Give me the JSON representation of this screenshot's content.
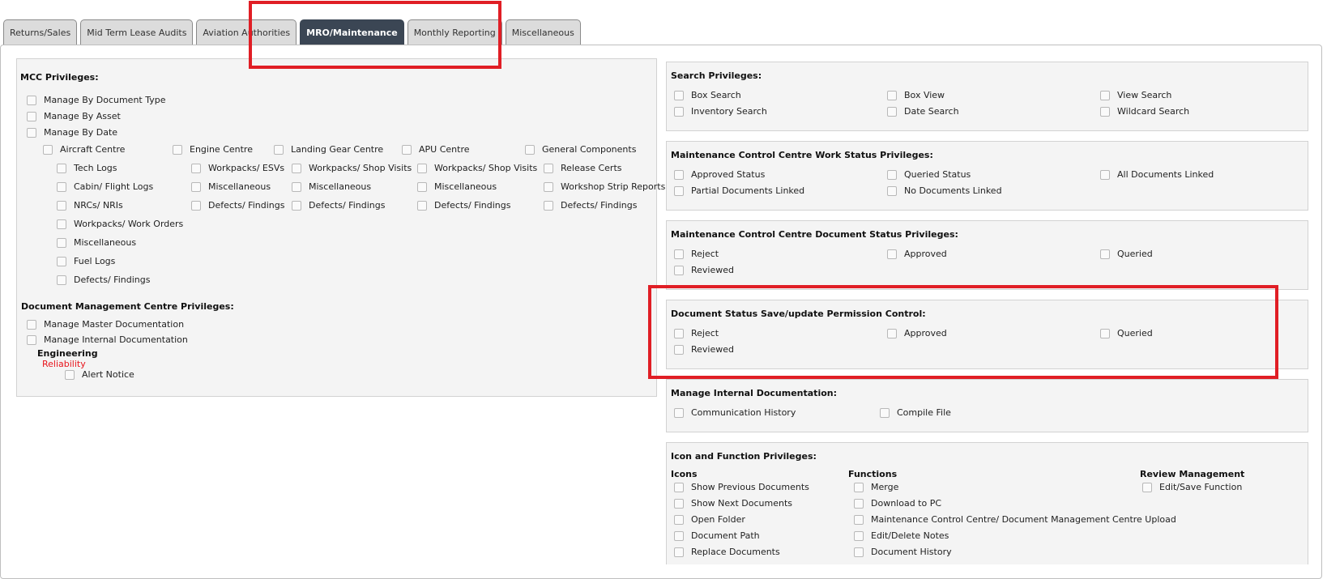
{
  "tabs": [
    {
      "label": "Returns/Sales",
      "active": false
    },
    {
      "label": "Mid Term Lease Audits",
      "active": false
    },
    {
      "label": "Aviation Authorities",
      "active": false
    },
    {
      "label": "MRO/Maintenance",
      "active": true
    },
    {
      "label": "Monthly Reporting",
      "active": false
    },
    {
      "label": "Miscellaneous",
      "active": false
    }
  ],
  "mcc": {
    "title": "MCC Privileges:",
    "manage": [
      "Manage By Document Type",
      "Manage By Asset",
      "Manage By Date"
    ],
    "centres": [
      "Aircraft Centre",
      "Engine Centre",
      "Landing Gear Centre",
      "APU Centre",
      "General Components"
    ],
    "aircraft_items": [
      "Tech Logs",
      "Cabin/ Flight Logs",
      "NRCs/ NRIs",
      "Workpacks/ Work Orders",
      "Miscellaneous",
      "Fuel Logs",
      "Defects/ Findings"
    ],
    "engine_items": [
      "Workpacks/ ESVs",
      "Miscellaneous",
      "Defects/ Findings"
    ],
    "landing_items": [
      "Workpacks/ Shop Visits",
      "Miscellaneous",
      "Defects/ Findings"
    ],
    "apu_items": [
      "Workpacks/ Shop Visits",
      "Miscellaneous",
      "Defects/ Findings"
    ],
    "general_items": [
      "Release Certs",
      "Workshop Strip Reports",
      "Defects/ Findings"
    ]
  },
  "dmc": {
    "title": "Document Management Centre Privileges:",
    "items": [
      "Manage Master Documentation",
      "Manage Internal Documentation"
    ],
    "engineering": "Engineering",
    "reliability": "Reliability",
    "alert": "Alert Notice"
  },
  "search": {
    "title": "Search Privileges:",
    "items": [
      "Box Search",
      "Box View",
      "View Search",
      "Inventory Search",
      "Date Search",
      "Wildcard Search"
    ]
  },
  "work_status": {
    "title": "Maintenance Control Centre Work Status Privileges:",
    "items": [
      "Approved Status",
      "Queried Status",
      "All Documents Linked",
      "Partial Documents Linked",
      "No Documents Linked"
    ]
  },
  "doc_status": {
    "title": "Maintenance Control Centre Document Status Privileges:",
    "items": [
      "Reject",
      "Approved",
      "Queried",
      "Reviewed"
    ]
  },
  "save_update": {
    "title": "Document Status Save/update Permission Control:",
    "items": [
      "Reject",
      "Approved",
      "Queried",
      "Reviewed"
    ]
  },
  "internal_doc": {
    "title": "Manage Internal Documentation:",
    "items": [
      "Communication History",
      "Compile File"
    ]
  },
  "icon_func": {
    "title": "Icon and Function Privileges:",
    "icons_head": "Icons",
    "functions_head": "Functions",
    "review_head": "Review Management",
    "icons": [
      "Show Previous Documents",
      "Show Next Documents",
      "Open Folder",
      "Document Path",
      "Replace Documents"
    ],
    "functions": [
      "Merge",
      "Download to PC",
      "Maintenance Control Centre/ Document Management Centre Upload",
      "Edit/Delete Notes",
      "Document History"
    ],
    "review": [
      "Edit/Save Function"
    ]
  },
  "colors": {
    "active_tab": "#3b4654",
    "highlight": "#e01e25",
    "reliability": "#e8141b"
  }
}
